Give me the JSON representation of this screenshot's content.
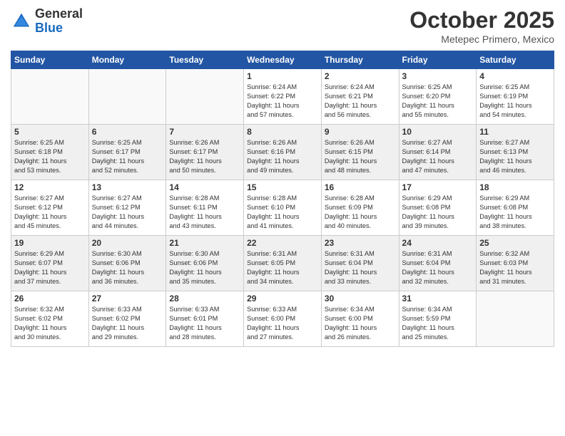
{
  "header": {
    "logo_general": "General",
    "logo_blue": "Blue",
    "month_title": "October 2025",
    "location": "Metepec Primero, Mexico"
  },
  "days_of_week": [
    "Sunday",
    "Monday",
    "Tuesday",
    "Wednesday",
    "Thursday",
    "Friday",
    "Saturday"
  ],
  "weeks": [
    [
      {
        "day": "",
        "info": ""
      },
      {
        "day": "",
        "info": ""
      },
      {
        "day": "",
        "info": ""
      },
      {
        "day": "1",
        "info": "Sunrise: 6:24 AM\nSunset: 6:22 PM\nDaylight: 11 hours\nand 57 minutes."
      },
      {
        "day": "2",
        "info": "Sunrise: 6:24 AM\nSunset: 6:21 PM\nDaylight: 11 hours\nand 56 minutes."
      },
      {
        "day": "3",
        "info": "Sunrise: 6:25 AM\nSunset: 6:20 PM\nDaylight: 11 hours\nand 55 minutes."
      },
      {
        "day": "4",
        "info": "Sunrise: 6:25 AM\nSunset: 6:19 PM\nDaylight: 11 hours\nand 54 minutes."
      }
    ],
    [
      {
        "day": "5",
        "info": "Sunrise: 6:25 AM\nSunset: 6:18 PM\nDaylight: 11 hours\nand 53 minutes."
      },
      {
        "day": "6",
        "info": "Sunrise: 6:25 AM\nSunset: 6:17 PM\nDaylight: 11 hours\nand 52 minutes."
      },
      {
        "day": "7",
        "info": "Sunrise: 6:26 AM\nSunset: 6:17 PM\nDaylight: 11 hours\nand 50 minutes."
      },
      {
        "day": "8",
        "info": "Sunrise: 6:26 AM\nSunset: 6:16 PM\nDaylight: 11 hours\nand 49 minutes."
      },
      {
        "day": "9",
        "info": "Sunrise: 6:26 AM\nSunset: 6:15 PM\nDaylight: 11 hours\nand 48 minutes."
      },
      {
        "day": "10",
        "info": "Sunrise: 6:27 AM\nSunset: 6:14 PM\nDaylight: 11 hours\nand 47 minutes."
      },
      {
        "day": "11",
        "info": "Sunrise: 6:27 AM\nSunset: 6:13 PM\nDaylight: 11 hours\nand 46 minutes."
      }
    ],
    [
      {
        "day": "12",
        "info": "Sunrise: 6:27 AM\nSunset: 6:12 PM\nDaylight: 11 hours\nand 45 minutes."
      },
      {
        "day": "13",
        "info": "Sunrise: 6:27 AM\nSunset: 6:12 PM\nDaylight: 11 hours\nand 44 minutes."
      },
      {
        "day": "14",
        "info": "Sunrise: 6:28 AM\nSunset: 6:11 PM\nDaylight: 11 hours\nand 43 minutes."
      },
      {
        "day": "15",
        "info": "Sunrise: 6:28 AM\nSunset: 6:10 PM\nDaylight: 11 hours\nand 41 minutes."
      },
      {
        "day": "16",
        "info": "Sunrise: 6:28 AM\nSunset: 6:09 PM\nDaylight: 11 hours\nand 40 minutes."
      },
      {
        "day": "17",
        "info": "Sunrise: 6:29 AM\nSunset: 6:08 PM\nDaylight: 11 hours\nand 39 minutes."
      },
      {
        "day": "18",
        "info": "Sunrise: 6:29 AM\nSunset: 6:08 PM\nDaylight: 11 hours\nand 38 minutes."
      }
    ],
    [
      {
        "day": "19",
        "info": "Sunrise: 6:29 AM\nSunset: 6:07 PM\nDaylight: 11 hours\nand 37 minutes."
      },
      {
        "day": "20",
        "info": "Sunrise: 6:30 AM\nSunset: 6:06 PM\nDaylight: 11 hours\nand 36 minutes."
      },
      {
        "day": "21",
        "info": "Sunrise: 6:30 AM\nSunset: 6:06 PM\nDaylight: 11 hours\nand 35 minutes."
      },
      {
        "day": "22",
        "info": "Sunrise: 6:31 AM\nSunset: 6:05 PM\nDaylight: 11 hours\nand 34 minutes."
      },
      {
        "day": "23",
        "info": "Sunrise: 6:31 AM\nSunset: 6:04 PM\nDaylight: 11 hours\nand 33 minutes."
      },
      {
        "day": "24",
        "info": "Sunrise: 6:31 AM\nSunset: 6:04 PM\nDaylight: 11 hours\nand 32 minutes."
      },
      {
        "day": "25",
        "info": "Sunrise: 6:32 AM\nSunset: 6:03 PM\nDaylight: 11 hours\nand 31 minutes."
      }
    ],
    [
      {
        "day": "26",
        "info": "Sunrise: 6:32 AM\nSunset: 6:02 PM\nDaylight: 11 hours\nand 30 minutes."
      },
      {
        "day": "27",
        "info": "Sunrise: 6:33 AM\nSunset: 6:02 PM\nDaylight: 11 hours\nand 29 minutes."
      },
      {
        "day": "28",
        "info": "Sunrise: 6:33 AM\nSunset: 6:01 PM\nDaylight: 11 hours\nand 28 minutes."
      },
      {
        "day": "29",
        "info": "Sunrise: 6:33 AM\nSunset: 6:00 PM\nDaylight: 11 hours\nand 27 minutes."
      },
      {
        "day": "30",
        "info": "Sunrise: 6:34 AM\nSunset: 6:00 PM\nDaylight: 11 hours\nand 26 minutes."
      },
      {
        "day": "31",
        "info": "Sunrise: 6:34 AM\nSunset: 5:59 PM\nDaylight: 11 hours\nand 25 minutes."
      },
      {
        "day": "",
        "info": ""
      }
    ]
  ]
}
